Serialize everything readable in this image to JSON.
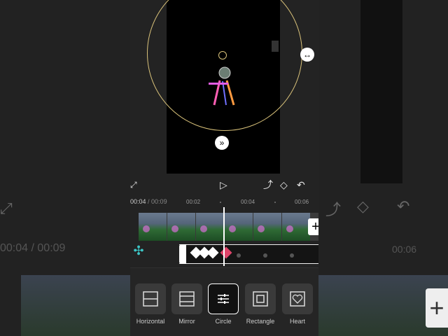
{
  "preview": {
    "resize_icon": "horizontal-double-arrow-icon",
    "feather_icon": "double-chevron-down-icon"
  },
  "controls": {
    "fullscreen_icon": "fullscreen-icon",
    "play_icon": "play-icon",
    "keyframe_graph_icon": "keyframe-curve-icon",
    "keyframe_add_icon": "keyframe-diamond-icon",
    "undo_icon": "undo-icon"
  },
  "timeline": {
    "current_time": "00:04",
    "separator": " / ",
    "total_time": "00:09",
    "ruler": [
      "00:02",
      "00:04",
      "00:06"
    ],
    "add_clip_label": "+"
  },
  "mask_options": [
    {
      "label": "Horizontal",
      "icon": "horizontal-mask-icon",
      "selected": false
    },
    {
      "label": "Mirror",
      "icon": "mirror-mask-icon",
      "selected": false
    },
    {
      "label": "Circle",
      "icon": "circle-mask-icon",
      "selected": true
    },
    {
      "label": "Rectangle",
      "icon": "rectangle-mask-icon",
      "selected": false
    },
    {
      "label": "Heart",
      "icon": "heart-mask-icon",
      "selected": false
    }
  ],
  "background": {
    "left_time": "00:04",
    "left_sep": " / ",
    "left_total": "00:09",
    "right_time": "00:06",
    "right_add": "+"
  },
  "colors": {
    "mask_outline": "#d9c27a",
    "active_keyframe": "#e0446a",
    "layer_accent": "#3cc6c6"
  }
}
